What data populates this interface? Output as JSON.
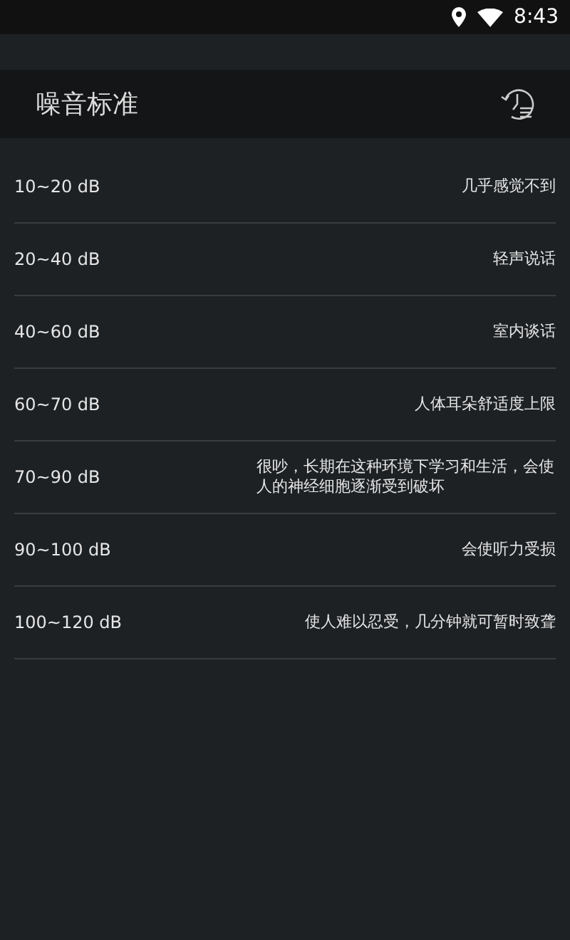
{
  "status_bar": {
    "time": "8:43"
  },
  "header": {
    "title": "噪音标准"
  },
  "rows": [
    {
      "range": "10~20 dB",
      "description": "几乎感觉不到"
    },
    {
      "range": "20~40 dB",
      "description": "轻声说话"
    },
    {
      "range": "40~60 dB",
      "description": "室内谈话"
    },
    {
      "range": "60~70 dB",
      "description": "人体耳朵舒适度上限"
    },
    {
      "range": "70~90 dB",
      "description": "很吵，长期在这种环境下学习和生活，会使人的神经细胞逐渐受到破坏"
    },
    {
      "range": "90~100 dB",
      "description": "会使听力受损"
    },
    {
      "range": "100~120 dB",
      "description": "使人难以忍受，几分钟就可暂时致聋"
    }
  ]
}
